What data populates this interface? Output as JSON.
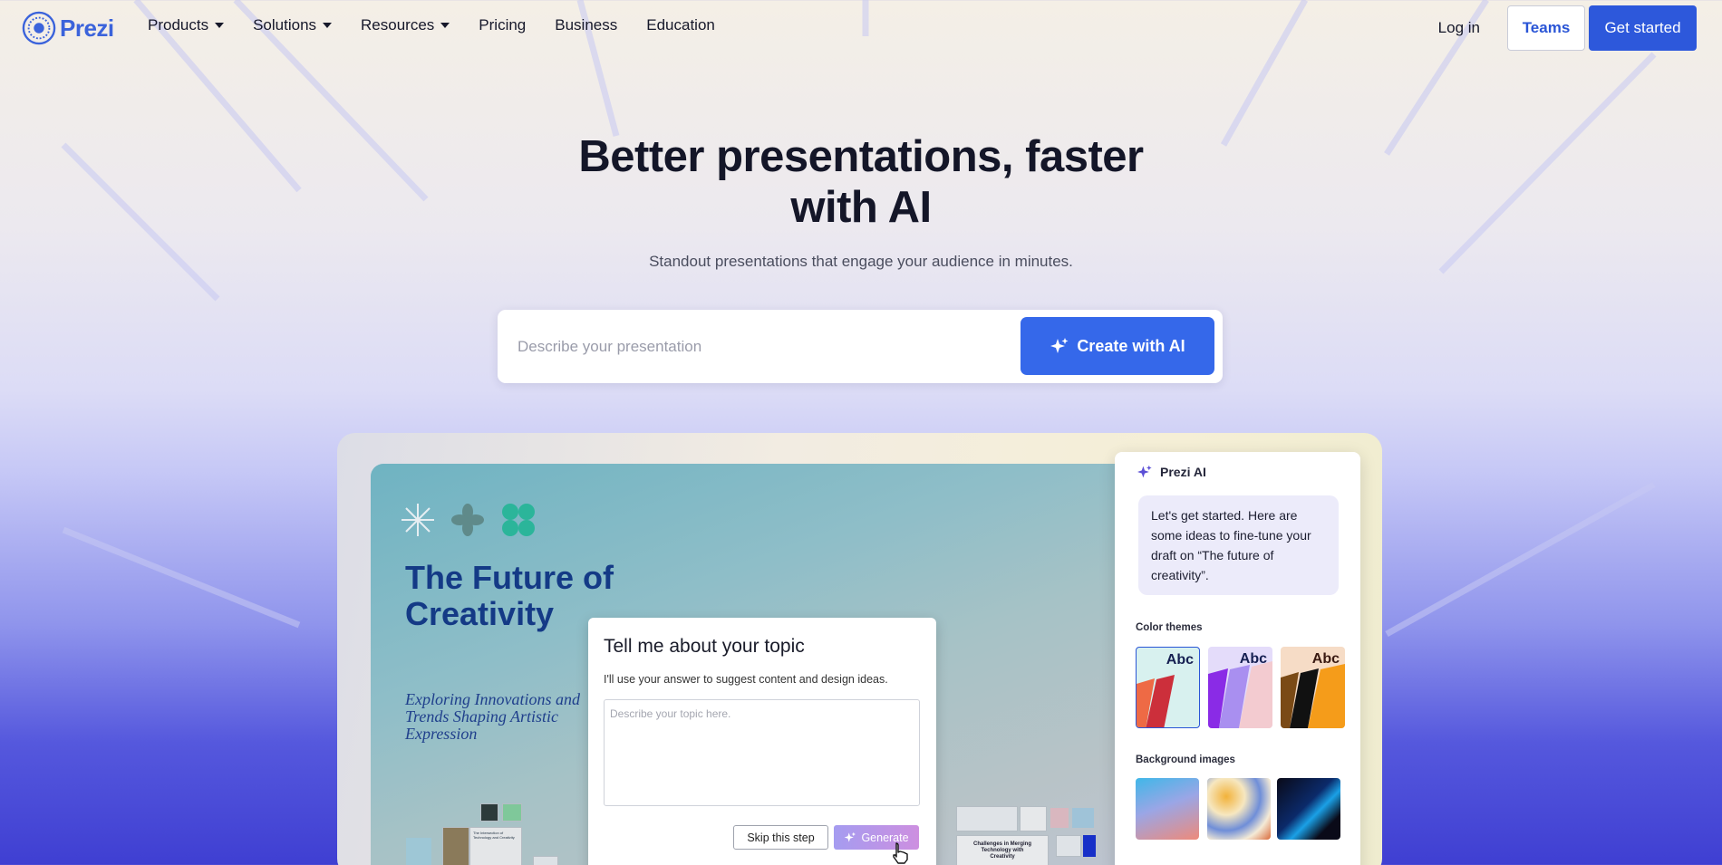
{
  "nav": {
    "logo_text": "Prezi",
    "items": [
      {
        "label": "Products",
        "has_dropdown": true
      },
      {
        "label": "Solutions",
        "has_dropdown": true
      },
      {
        "label": "Resources",
        "has_dropdown": true
      },
      {
        "label": "Pricing",
        "has_dropdown": false
      },
      {
        "label": "Business",
        "has_dropdown": false
      },
      {
        "label": "Education",
        "has_dropdown": false
      }
    ],
    "login": "Log in",
    "teams": "Teams",
    "get_started": "Get started"
  },
  "hero": {
    "title_line1": "Better presentations, faster",
    "title_line2": "with AI",
    "subtitle": "Standout presentations that engage your audience in minutes.",
    "prompt_placeholder": "Describe your presentation",
    "prompt_value": "",
    "create_button": "Create with AI"
  },
  "preview": {
    "slide_title": "The Future of Creativity",
    "slide_subtitle": "Exploring Innovations and Trends Shaping Artistic Expression",
    "thumb_labels": [
      "The Intersection of Technology and Creativity",
      "Challenges in Merging Technology with Creativity"
    ],
    "topic_card": {
      "title": "Tell me about your topic",
      "help": "I'll use your answer to suggest content and design ideas.",
      "placeholder": "Describe your topic here.",
      "skip": "Skip this step",
      "generate": "Generate"
    },
    "ai_panel": {
      "header": "Prezi AI",
      "message": "Let's get started. Here are some ideas to fine-tune your draft on “The future of creativity”.",
      "color_themes_label": "Color themes",
      "theme_sample": "Abc",
      "background_images_label": "Background images"
    }
  },
  "colors": {
    "brand": "#2d58db",
    "accent_button": "#3568ea",
    "slide_title": "#143a86"
  }
}
